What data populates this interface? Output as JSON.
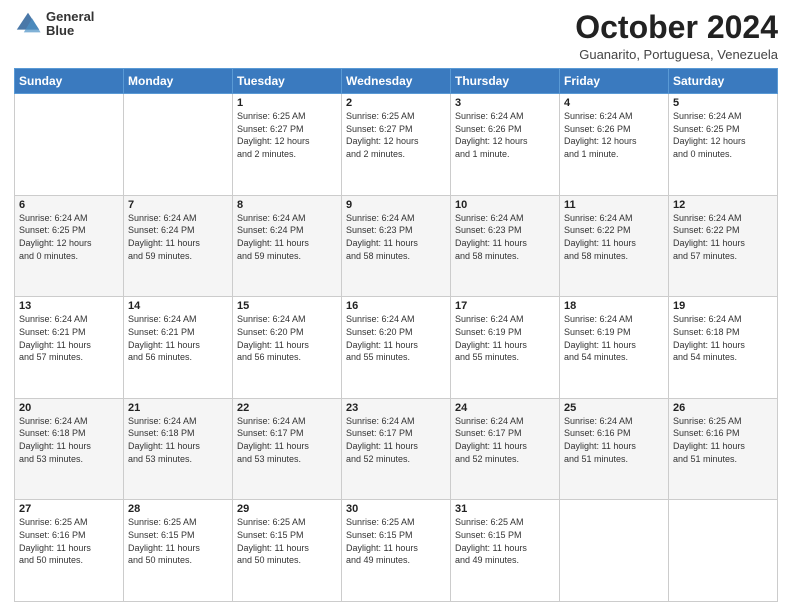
{
  "logo": {
    "line1": "General",
    "line2": "Blue"
  },
  "header": {
    "title": "October 2024",
    "subtitle": "Guanarito, Portuguesa, Venezuela"
  },
  "weekdays": [
    "Sunday",
    "Monday",
    "Tuesday",
    "Wednesday",
    "Thursday",
    "Friday",
    "Saturday"
  ],
  "weeks": [
    [
      {
        "day": "",
        "info": ""
      },
      {
        "day": "",
        "info": ""
      },
      {
        "day": "1",
        "info": "Sunrise: 6:25 AM\nSunset: 6:27 PM\nDaylight: 12 hours\nand 2 minutes."
      },
      {
        "day": "2",
        "info": "Sunrise: 6:25 AM\nSunset: 6:27 PM\nDaylight: 12 hours\nand 2 minutes."
      },
      {
        "day": "3",
        "info": "Sunrise: 6:24 AM\nSunset: 6:26 PM\nDaylight: 12 hours\nand 1 minute."
      },
      {
        "day": "4",
        "info": "Sunrise: 6:24 AM\nSunset: 6:26 PM\nDaylight: 12 hours\nand 1 minute."
      },
      {
        "day": "5",
        "info": "Sunrise: 6:24 AM\nSunset: 6:25 PM\nDaylight: 12 hours\nand 0 minutes."
      }
    ],
    [
      {
        "day": "6",
        "info": "Sunrise: 6:24 AM\nSunset: 6:25 PM\nDaylight: 12 hours\nand 0 minutes."
      },
      {
        "day": "7",
        "info": "Sunrise: 6:24 AM\nSunset: 6:24 PM\nDaylight: 11 hours\nand 59 minutes."
      },
      {
        "day": "8",
        "info": "Sunrise: 6:24 AM\nSunset: 6:24 PM\nDaylight: 11 hours\nand 59 minutes."
      },
      {
        "day": "9",
        "info": "Sunrise: 6:24 AM\nSunset: 6:23 PM\nDaylight: 11 hours\nand 58 minutes."
      },
      {
        "day": "10",
        "info": "Sunrise: 6:24 AM\nSunset: 6:23 PM\nDaylight: 11 hours\nand 58 minutes."
      },
      {
        "day": "11",
        "info": "Sunrise: 6:24 AM\nSunset: 6:22 PM\nDaylight: 11 hours\nand 58 minutes."
      },
      {
        "day": "12",
        "info": "Sunrise: 6:24 AM\nSunset: 6:22 PM\nDaylight: 11 hours\nand 57 minutes."
      }
    ],
    [
      {
        "day": "13",
        "info": "Sunrise: 6:24 AM\nSunset: 6:21 PM\nDaylight: 11 hours\nand 57 minutes."
      },
      {
        "day": "14",
        "info": "Sunrise: 6:24 AM\nSunset: 6:21 PM\nDaylight: 11 hours\nand 56 minutes."
      },
      {
        "day": "15",
        "info": "Sunrise: 6:24 AM\nSunset: 6:20 PM\nDaylight: 11 hours\nand 56 minutes."
      },
      {
        "day": "16",
        "info": "Sunrise: 6:24 AM\nSunset: 6:20 PM\nDaylight: 11 hours\nand 55 minutes."
      },
      {
        "day": "17",
        "info": "Sunrise: 6:24 AM\nSunset: 6:19 PM\nDaylight: 11 hours\nand 55 minutes."
      },
      {
        "day": "18",
        "info": "Sunrise: 6:24 AM\nSunset: 6:19 PM\nDaylight: 11 hours\nand 54 minutes."
      },
      {
        "day": "19",
        "info": "Sunrise: 6:24 AM\nSunset: 6:18 PM\nDaylight: 11 hours\nand 54 minutes."
      }
    ],
    [
      {
        "day": "20",
        "info": "Sunrise: 6:24 AM\nSunset: 6:18 PM\nDaylight: 11 hours\nand 53 minutes."
      },
      {
        "day": "21",
        "info": "Sunrise: 6:24 AM\nSunset: 6:18 PM\nDaylight: 11 hours\nand 53 minutes."
      },
      {
        "day": "22",
        "info": "Sunrise: 6:24 AM\nSunset: 6:17 PM\nDaylight: 11 hours\nand 53 minutes."
      },
      {
        "day": "23",
        "info": "Sunrise: 6:24 AM\nSunset: 6:17 PM\nDaylight: 11 hours\nand 52 minutes."
      },
      {
        "day": "24",
        "info": "Sunrise: 6:24 AM\nSunset: 6:17 PM\nDaylight: 11 hours\nand 52 minutes."
      },
      {
        "day": "25",
        "info": "Sunrise: 6:24 AM\nSunset: 6:16 PM\nDaylight: 11 hours\nand 51 minutes."
      },
      {
        "day": "26",
        "info": "Sunrise: 6:25 AM\nSunset: 6:16 PM\nDaylight: 11 hours\nand 51 minutes."
      }
    ],
    [
      {
        "day": "27",
        "info": "Sunrise: 6:25 AM\nSunset: 6:16 PM\nDaylight: 11 hours\nand 50 minutes."
      },
      {
        "day": "28",
        "info": "Sunrise: 6:25 AM\nSunset: 6:15 PM\nDaylight: 11 hours\nand 50 minutes."
      },
      {
        "day": "29",
        "info": "Sunrise: 6:25 AM\nSunset: 6:15 PM\nDaylight: 11 hours\nand 50 minutes."
      },
      {
        "day": "30",
        "info": "Sunrise: 6:25 AM\nSunset: 6:15 PM\nDaylight: 11 hours\nand 49 minutes."
      },
      {
        "day": "31",
        "info": "Sunrise: 6:25 AM\nSunset: 6:15 PM\nDaylight: 11 hours\nand 49 minutes."
      },
      {
        "day": "",
        "info": ""
      },
      {
        "day": "",
        "info": ""
      }
    ]
  ]
}
